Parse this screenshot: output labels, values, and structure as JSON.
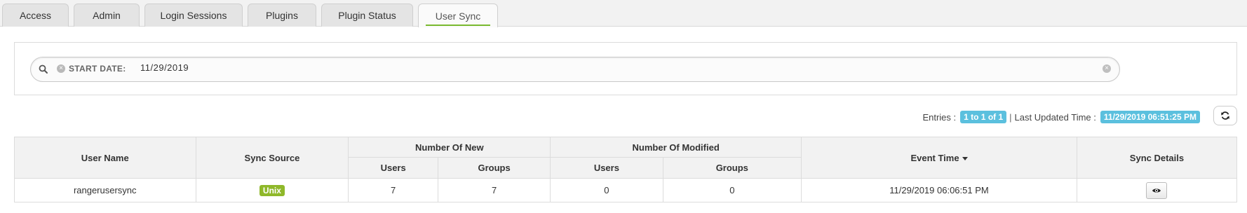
{
  "tabs": [
    {
      "label": "Access"
    },
    {
      "label": "Admin"
    },
    {
      "label": "Login Sessions"
    },
    {
      "label": "Plugins"
    },
    {
      "label": "Plugin Status"
    },
    {
      "label": "User Sync",
      "active": true
    }
  ],
  "search": {
    "facet_label": "START DATE:",
    "facet_value": "11/29/2019",
    "icon": "search-icon"
  },
  "entries": {
    "label": "Entries :",
    "range": "1 to 1 of 1",
    "separator": "|",
    "last_updated_label": "Last Updated Time :",
    "last_updated_value": "11/29/2019 06:51:25 PM"
  },
  "table": {
    "group_headers": {
      "new": "Number Of New",
      "modified": "Number Of Modified"
    },
    "columns": {
      "user_name": "User Name",
      "sync_source": "Sync Source",
      "new_users": "Users",
      "new_groups": "Groups",
      "mod_users": "Users",
      "mod_groups": "Groups",
      "event_time": "Event Time",
      "sync_details": "Sync Details"
    },
    "rows": [
      {
        "user_name": "rangerusersync",
        "sync_source": "Unix",
        "new_users": "7",
        "new_groups": "7",
        "mod_users": "0",
        "mod_groups": "0",
        "event_time": "11/29/2019 06:06:51 PM"
      }
    ]
  },
  "colors": {
    "active_tab_underline": "#79b92f",
    "info_badge": "#5bc0de",
    "source_badge": "#8fb82a"
  }
}
